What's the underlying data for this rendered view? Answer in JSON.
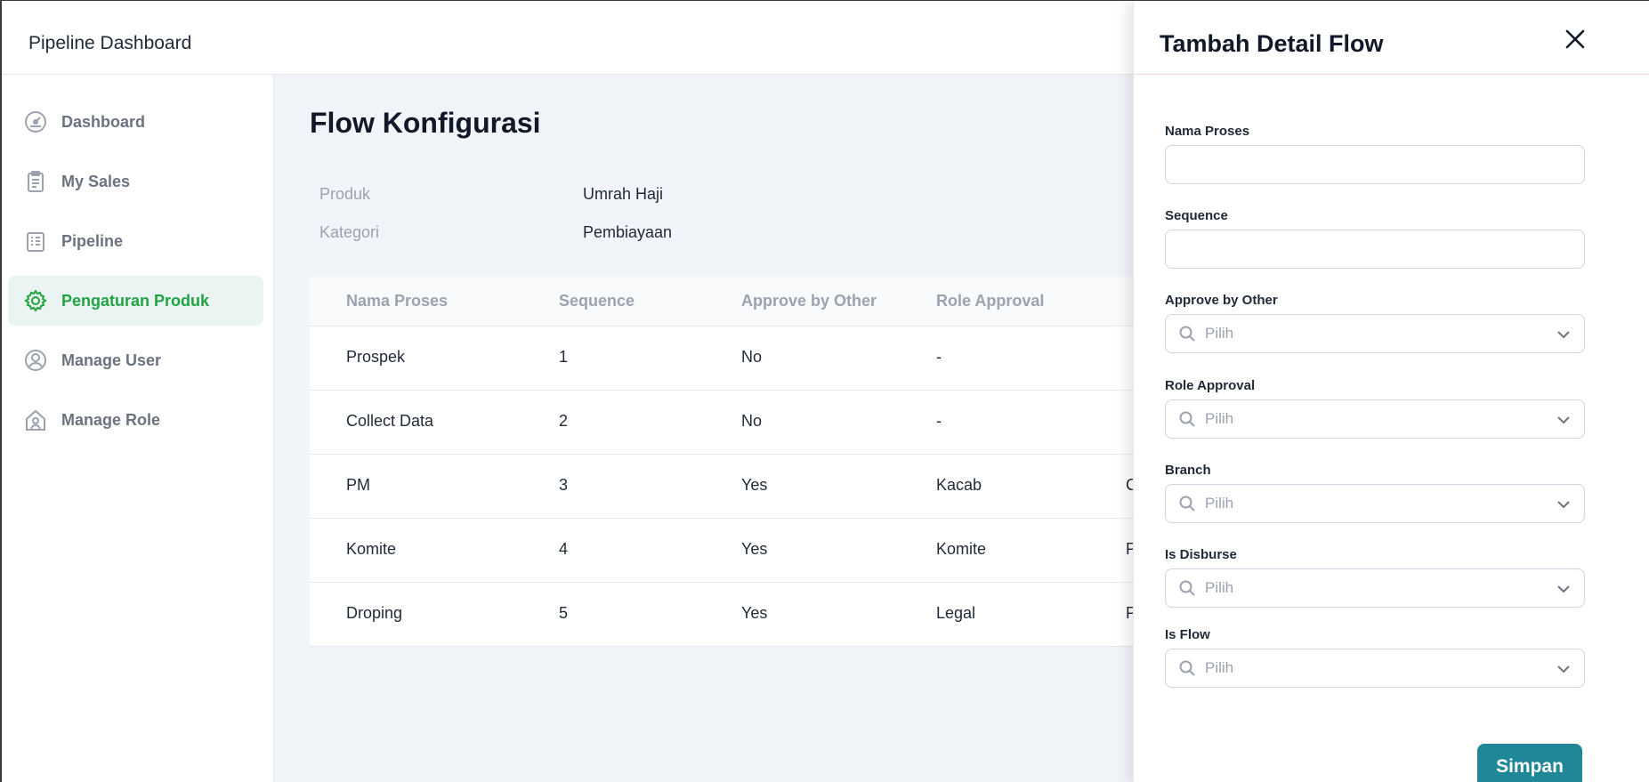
{
  "app": {
    "title": "Pipeline Dashboard"
  },
  "sidebar": {
    "items": [
      {
        "label": "Dashboard",
        "icon": "dashboard-gauge-icon",
        "active": false
      },
      {
        "label": "My Sales",
        "icon": "clipboard-list-icon",
        "active": false
      },
      {
        "label": "Pipeline",
        "icon": "pipeline-chart-icon",
        "active": false
      },
      {
        "label": "Pengaturan Produk",
        "icon": "gear-icon",
        "active": true
      },
      {
        "label": "Manage User",
        "icon": "user-circle-icon",
        "active": false
      },
      {
        "label": "Manage Role",
        "icon": "house-user-icon",
        "active": false
      }
    ]
  },
  "main": {
    "title": "Flow Konfigurasi",
    "meta": {
      "produk_label": "Produk",
      "produk_value": "Umrah Haji",
      "kategori_label": "Kategori",
      "kategori_value": "Pembiayaan"
    },
    "table": {
      "columns": [
        "Nama Proses",
        "Sequence",
        "Approve by Other",
        "Role Approval"
      ],
      "rows": [
        [
          "Prospek",
          "1",
          "No",
          "-",
          ""
        ],
        [
          "Collect Data",
          "2",
          "No",
          "-",
          ""
        ],
        [
          "PM",
          "3",
          "Yes",
          "Kacab",
          "C"
        ],
        [
          "Komite",
          "4",
          "Yes",
          "Komite",
          "P"
        ],
        [
          "Droping",
          "5",
          "Yes",
          "Legal",
          "P"
        ]
      ]
    }
  },
  "drawer": {
    "title": "Tambah Detail Flow",
    "fields": {
      "nama_proses": {
        "label": "Nama Proses",
        "value": ""
      },
      "sequence": {
        "label": "Sequence",
        "value": ""
      },
      "approve_by_other": {
        "label": "Approve by Other",
        "placeholder": "Pilih"
      },
      "role_approval": {
        "label": "Role Approval",
        "placeholder": "Pilih"
      },
      "branch": {
        "label": "Branch",
        "placeholder": "Pilih"
      },
      "is_disburse": {
        "label": "Is Disburse",
        "placeholder": "Pilih"
      },
      "is_flow": {
        "label": "Is Flow",
        "placeholder": "Pilih"
      }
    },
    "save_label": "Simpan"
  },
  "colors": {
    "accent_green": "#22a341",
    "active_bg": "#eaf5f3",
    "primary_button": "#1f8797",
    "main_bg": "#f1f4f8"
  }
}
